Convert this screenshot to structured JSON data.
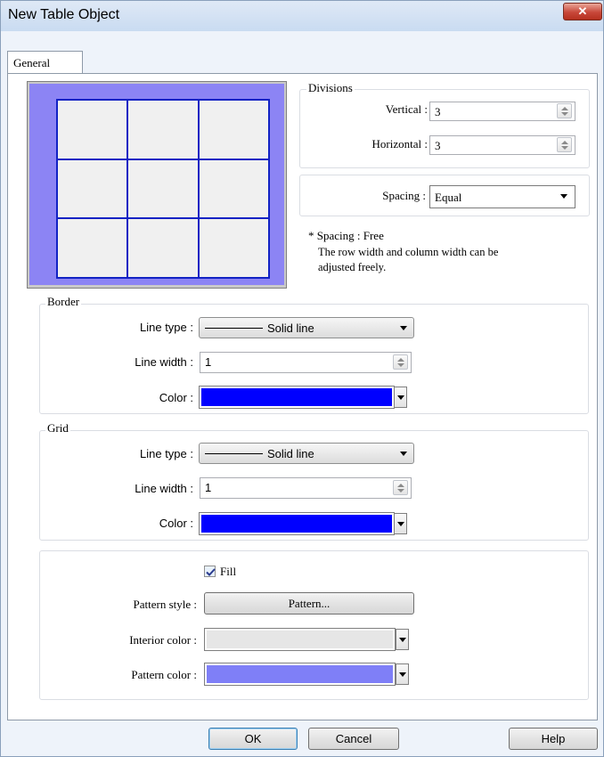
{
  "window": {
    "title": "New Table Object",
    "close_glyph": "✕"
  },
  "tabs": [
    {
      "label": "General"
    }
  ],
  "divisions": {
    "title": "Divisions",
    "vertical_label": "Vertical :",
    "vertical_value": "3",
    "horizontal_label": "Horizontal :",
    "horizontal_value": "3"
  },
  "spacing": {
    "label": "Spacing :",
    "value": "Equal"
  },
  "note": {
    "line1": "* Spacing : Free",
    "line2": "The row width and column width can be",
    "line3": "adjusted freely."
  },
  "preview": {
    "rows": 3,
    "columns": 3,
    "fill_color": "#f0f0f0",
    "border_color": "#8c84f4",
    "grid_color": "#1222c4"
  },
  "border": {
    "title": "Border",
    "line_type_label": "Line type :",
    "line_type_value": "Solid line",
    "line_width_label": "Line width :",
    "line_width_value": "1",
    "color_label": "Color :",
    "color": "#0000ff"
  },
  "grid": {
    "title": "Grid",
    "line_type_label": "Line type :",
    "line_type_value": "Solid line",
    "line_width_label": "Line width :",
    "line_width_value": "1",
    "color_label": "Color :",
    "color": "#0000ff"
  },
  "fill": {
    "checkbox_label": "Fill",
    "checked": true,
    "pattern_style_label": "Pattern style :",
    "pattern_button": "Pattern...",
    "interior_color_label": "Interior color :",
    "interior_color": "#e6e6e6",
    "pattern_color_label": "Pattern color :",
    "pattern_color": "#7f7ff7"
  },
  "buttons": {
    "ok": "OK",
    "cancel": "Cancel",
    "help": "Help"
  },
  "icons": [
    "close-icon",
    "spin-up-icon",
    "spin-down-icon",
    "dropdown-arrow-icon",
    "checkmark-icon"
  ]
}
